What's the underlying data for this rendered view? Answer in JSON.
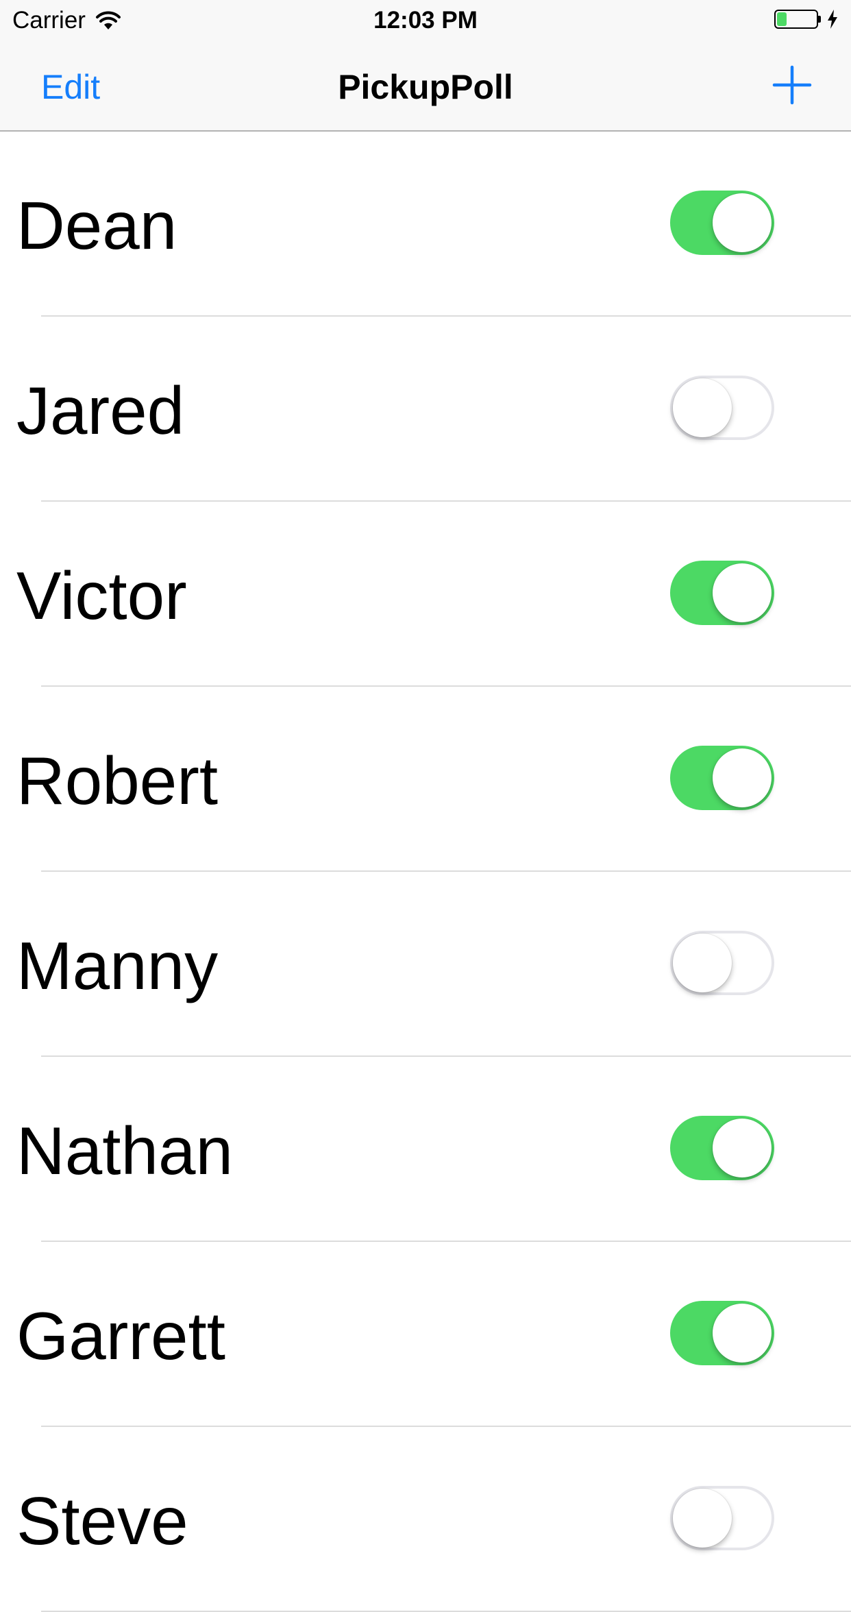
{
  "status_bar": {
    "carrier": "Carrier",
    "time": "12:03 PM",
    "battery_level": 0.25
  },
  "nav": {
    "edit_label": "Edit",
    "title": "PickupPoll",
    "add_icon": "plus-icon"
  },
  "colors": {
    "accent": "#157efb",
    "switch_on": "#4cd964",
    "switch_off_border": "#e5e5ea"
  },
  "players": [
    {
      "name": "Dean",
      "enabled": true
    },
    {
      "name": "Jared",
      "enabled": false
    },
    {
      "name": "Victor",
      "enabled": true
    },
    {
      "name": "Robert",
      "enabled": true
    },
    {
      "name": "Manny",
      "enabled": false
    },
    {
      "name": "Nathan",
      "enabled": true
    },
    {
      "name": "Garrett",
      "enabled": true
    },
    {
      "name": "Steve",
      "enabled": false
    }
  ]
}
